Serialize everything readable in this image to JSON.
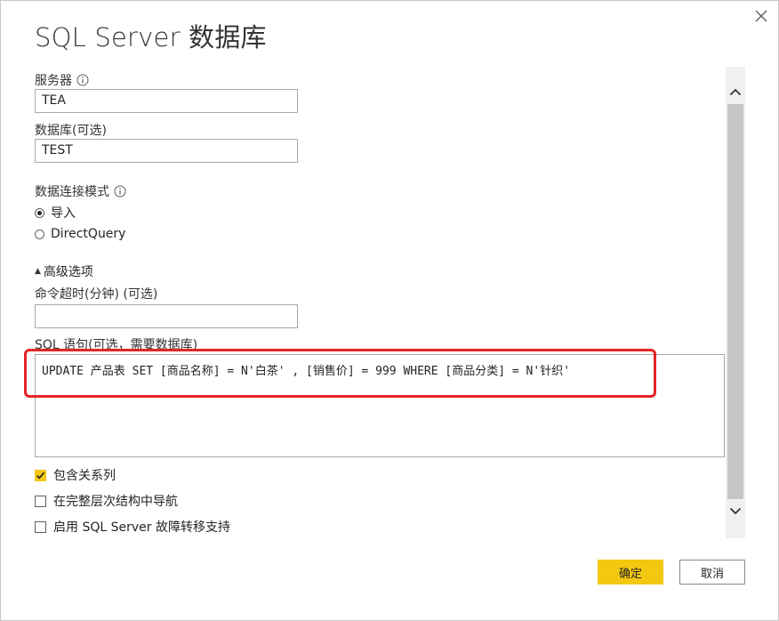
{
  "dialog": {
    "title": "SQL Server 数据库",
    "close_icon": "close-icon"
  },
  "server": {
    "label": "服务器",
    "value": "TEA"
  },
  "database": {
    "label": "数据库(可选)",
    "value": "TEST"
  },
  "connectivity": {
    "label": "数据连接模式",
    "options": [
      {
        "label": "导入",
        "selected": true
      },
      {
        "label": "DirectQuery",
        "selected": false
      }
    ]
  },
  "advanced": {
    "toggle_label": "高级选项",
    "timeout_label": "命令超时(分钟) (可选)",
    "timeout_value": "",
    "sql_label": "SQL 语句(可选，需要数据库)",
    "sql_value": "UPDATE 产品表 SET [商品名称] = N'白茶' , [销售价] = 999 WHERE [商品分类] = N'针织'"
  },
  "options": [
    {
      "label": "包含关系列",
      "checked": true
    },
    {
      "label": "在完整层次结构中导航",
      "checked": false
    },
    {
      "label": "启用 SQL Server 故障转移支持",
      "checked": false
    }
  ],
  "buttons": {
    "ok_label": "确定",
    "cancel_label": "取消"
  },
  "colors": {
    "accent": "#f2c811",
    "highlight": "#e52424"
  }
}
